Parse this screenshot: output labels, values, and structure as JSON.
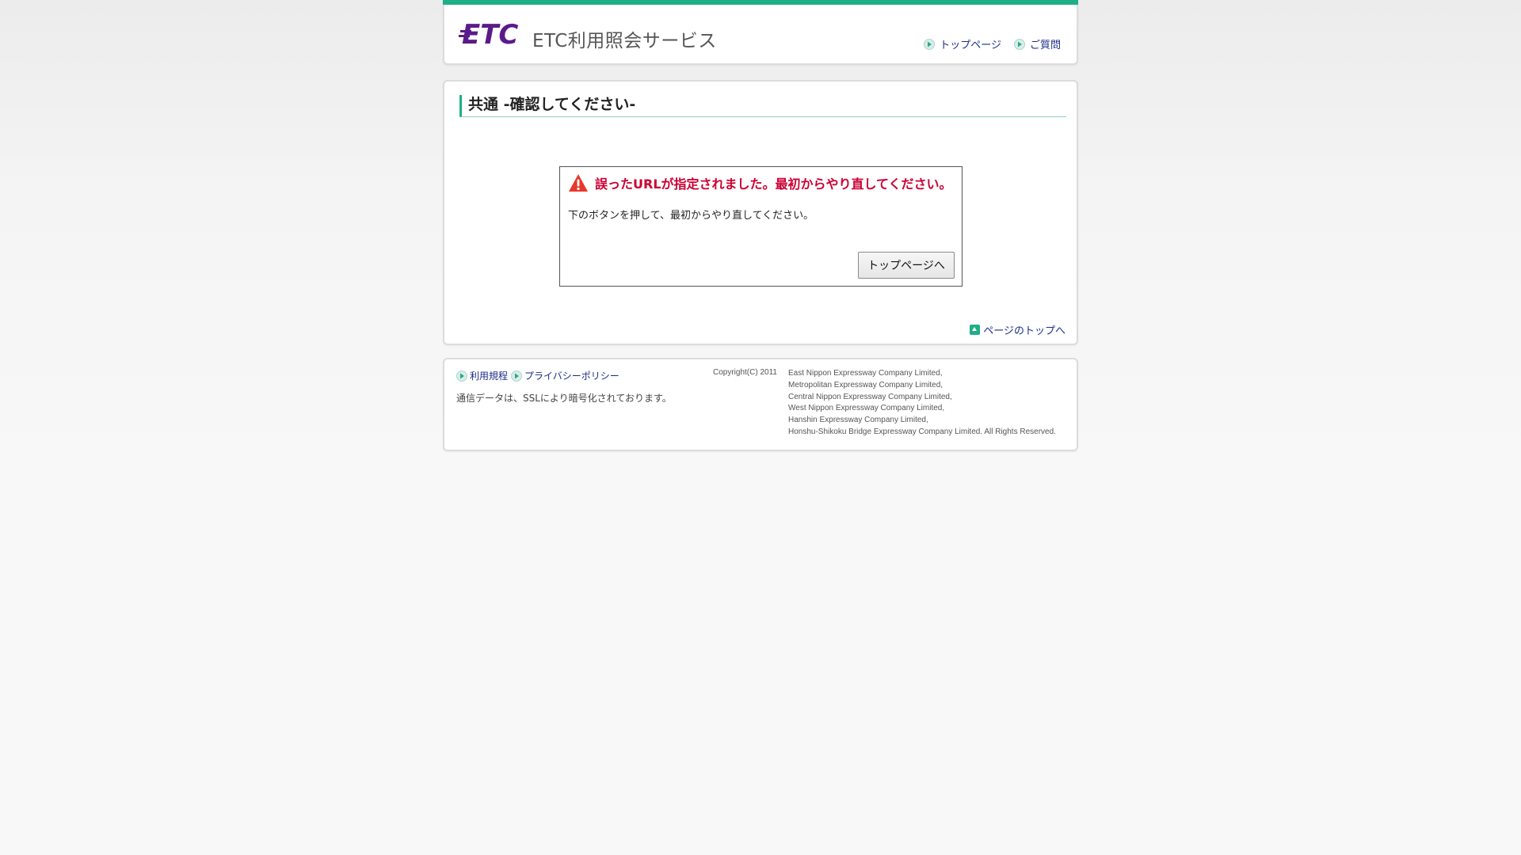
{
  "header": {
    "logo_text": "ETC",
    "service_name": "ETC利用照会サービス",
    "nav": [
      {
        "label": "トップページ"
      },
      {
        "label": "ご質問"
      }
    ]
  },
  "main": {
    "page_title": "共通 -確認してください-",
    "error_title": "誤ったURLが指定されました。最初からやり直してください。",
    "error_body": "下のボタンを押して、最初からやり直してください。",
    "button_label": "トップページへ",
    "back_to_top": "ページのトップへ"
  },
  "footer": {
    "links": [
      {
        "label": "利用規程"
      },
      {
        "label": "プライバシーポリシー"
      }
    ],
    "ssl_note": "通信データは、SSLにより暗号化されております。",
    "copyright": "Copyright(C) 2011",
    "companies": [
      "East Nippon Expressway Company Limited,",
      "Metropolitan Expressway Company Limited,",
      "Central Nippon Expressway Company Limited,",
      "West Nippon Expressway Company Limited,",
      "Hanshin Expressway Company Limited,",
      "Honshu-Shikoku Bridge Expressway Company Limited. All Rights Reserved."
    ]
  },
  "colors": {
    "accent": "#1fae88",
    "error": "#cc0033",
    "link": "#1a2d8a",
    "logo": "#5b1a8a"
  }
}
